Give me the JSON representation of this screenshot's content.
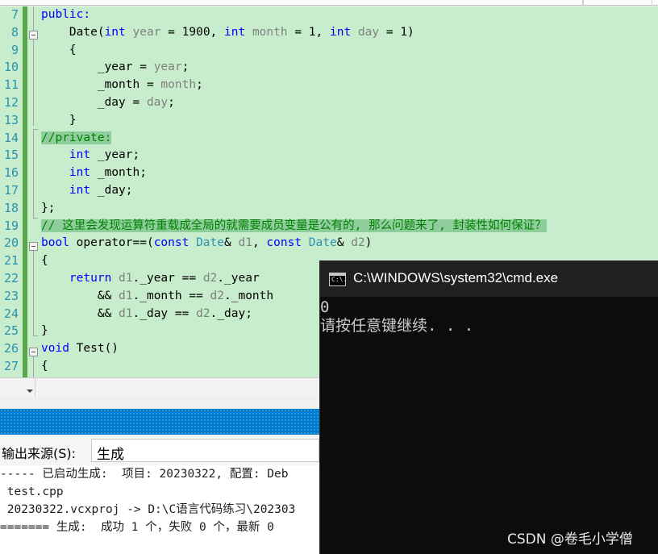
{
  "editor": {
    "lines": [
      {
        "num": "7",
        "segments": [
          {
            "t": "public:",
            "c": "kw"
          }
        ]
      },
      {
        "num": "8",
        "segments": [
          {
            "t": "    Date(",
            "c": ""
          },
          {
            "t": "int",
            "c": "kw"
          },
          {
            "t": " ",
            "c": ""
          },
          {
            "t": "year",
            "c": "pm"
          },
          {
            "t": " = 1900, ",
            "c": ""
          },
          {
            "t": "int",
            "c": "kw"
          },
          {
            "t": " ",
            "c": ""
          },
          {
            "t": "month",
            "c": "pm"
          },
          {
            "t": " = 1, ",
            "c": ""
          },
          {
            "t": "int",
            "c": "kw"
          },
          {
            "t": " ",
            "c": ""
          },
          {
            "t": "day",
            "c": "pm"
          },
          {
            "t": " = 1)",
            "c": ""
          }
        ]
      },
      {
        "num": "9",
        "segments": [
          {
            "t": "    {",
            "c": ""
          }
        ]
      },
      {
        "num": "10",
        "segments": [
          {
            "t": "        _year = ",
            "c": ""
          },
          {
            "t": "year",
            "c": "pm"
          },
          {
            "t": ";",
            "c": ""
          }
        ]
      },
      {
        "num": "11",
        "segments": [
          {
            "t": "        _month = ",
            "c": ""
          },
          {
            "t": "month",
            "c": "pm"
          },
          {
            "t": ";",
            "c": ""
          }
        ]
      },
      {
        "num": "12",
        "segments": [
          {
            "t": "        _day = ",
            "c": ""
          },
          {
            "t": "day",
            "c": "pm"
          },
          {
            "t": ";",
            "c": ""
          }
        ]
      },
      {
        "num": "13",
        "segments": [
          {
            "t": "    }",
            "c": ""
          }
        ]
      },
      {
        "num": "14",
        "segments": [
          {
            "t": "//private:",
            "c": "cm hl"
          }
        ]
      },
      {
        "num": "15",
        "segments": [
          {
            "t": "    ",
            "c": ""
          },
          {
            "t": "int",
            "c": "kw"
          },
          {
            "t": " _year;",
            "c": ""
          }
        ]
      },
      {
        "num": "16",
        "segments": [
          {
            "t": "    ",
            "c": ""
          },
          {
            "t": "int",
            "c": "kw"
          },
          {
            "t": " _month;",
            "c": ""
          }
        ]
      },
      {
        "num": "17",
        "segments": [
          {
            "t": "    ",
            "c": ""
          },
          {
            "t": "int",
            "c": "kw"
          },
          {
            "t": " _day;",
            "c": ""
          }
        ]
      },
      {
        "num": "18",
        "segments": [
          {
            "t": "};",
            "c": ""
          }
        ]
      },
      {
        "num": "19",
        "segments": [
          {
            "t": "// 这里会发现运算符重载成全局的就需要成员变量是公有的, 那么问题来了, 封装性如何保证？",
            "c": "cm hl"
          }
        ]
      },
      {
        "num": "20",
        "segments": [
          {
            "t": "bool",
            "c": "kw"
          },
          {
            "t": " operator==(",
            "c": ""
          },
          {
            "t": "const",
            "c": "kw"
          },
          {
            "t": " ",
            "c": ""
          },
          {
            "t": "Date",
            "c": "ty"
          },
          {
            "t": "& ",
            "c": ""
          },
          {
            "t": "d1",
            "c": "pm"
          },
          {
            "t": ", ",
            "c": ""
          },
          {
            "t": "const",
            "c": "kw"
          },
          {
            "t": " ",
            "c": ""
          },
          {
            "t": "Date",
            "c": "ty"
          },
          {
            "t": "& ",
            "c": ""
          },
          {
            "t": "d2",
            "c": "pm"
          },
          {
            "t": ")",
            "c": ""
          }
        ]
      },
      {
        "num": "21",
        "segments": [
          {
            "t": "{",
            "c": ""
          }
        ]
      },
      {
        "num": "22",
        "segments": [
          {
            "t": "    ",
            "c": ""
          },
          {
            "t": "return",
            "c": "kw"
          },
          {
            "t": " ",
            "c": ""
          },
          {
            "t": "d1",
            "c": "pm"
          },
          {
            "t": "._year == ",
            "c": ""
          },
          {
            "t": "d2",
            "c": "pm"
          },
          {
            "t": "._year",
            "c": ""
          }
        ]
      },
      {
        "num": "23",
        "segments": [
          {
            "t": "        && ",
            "c": ""
          },
          {
            "t": "d1",
            "c": "pm"
          },
          {
            "t": "._month == ",
            "c": ""
          },
          {
            "t": "d2",
            "c": "pm"
          },
          {
            "t": "._month",
            "c": ""
          }
        ]
      },
      {
        "num": "24",
        "segments": [
          {
            "t": "        && ",
            "c": ""
          },
          {
            "t": "d1",
            "c": "pm"
          },
          {
            "t": "._day == ",
            "c": ""
          },
          {
            "t": "d2",
            "c": "pm"
          },
          {
            "t": "._day;",
            "c": ""
          }
        ]
      },
      {
        "num": "25",
        "segments": [
          {
            "t": "}",
            "c": ""
          }
        ]
      },
      {
        "num": "26",
        "segments": [
          {
            "t": "void",
            "c": "kw"
          },
          {
            "t": " Test()",
            "c": ""
          }
        ]
      },
      {
        "num": "27",
        "segments": [
          {
            "t": "{",
            "c": ""
          }
        ]
      }
    ]
  },
  "output": {
    "source_label": "输出来源(S):",
    "source_value": "生成",
    "lines": [
      "----- 已启动生成:  项目: 20230322, 配置: Deb",
      " test.cpp",
      " 20230322.vcxproj -> D:\\C语言代码练习\\202303",
      "======= 生成:  成功 1 个，失败 0 个，最新 0"
    ]
  },
  "cmd": {
    "title": "C:\\WINDOWS\\system32\\cmd.exe",
    "icon_text": "C:\\.",
    "lines": [
      "0",
      "请按任意键继续. . ."
    ]
  },
  "watermark": "CSDN @卷毛小学僧",
  "colors": {
    "editor_bg": "#c7edcc",
    "keyword": "#0000ff",
    "type": "#2b91af",
    "param": "#808080",
    "comment": "#008000",
    "panel_title": "#007acc",
    "console_bg": "#0c0c0c"
  }
}
